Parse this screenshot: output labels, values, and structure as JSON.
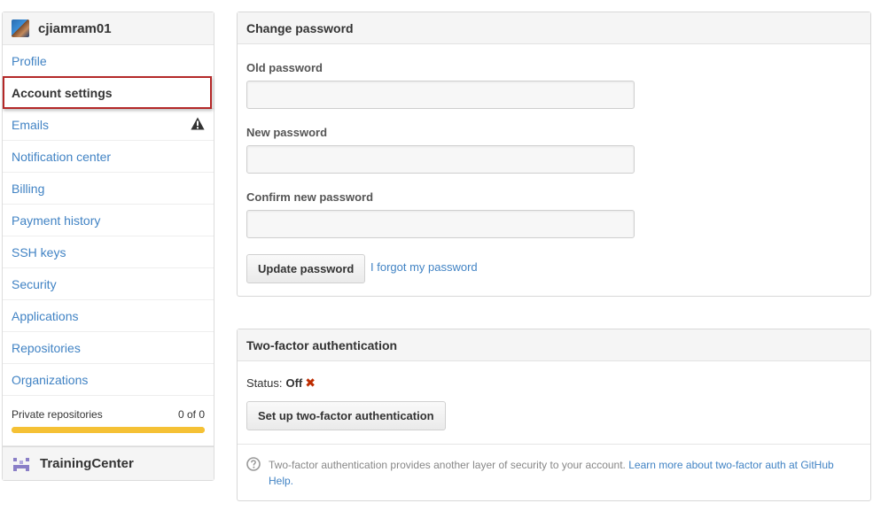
{
  "user": {
    "name": "cjiamram01"
  },
  "sidebar": {
    "items": [
      {
        "label": "Profile"
      },
      {
        "label": "Account settings"
      },
      {
        "label": "Emails"
      },
      {
        "label": "Notification center"
      },
      {
        "label": "Billing"
      },
      {
        "label": "Payment history"
      },
      {
        "label": "SSH keys"
      },
      {
        "label": "Security"
      },
      {
        "label": "Applications"
      },
      {
        "label": "Repositories"
      },
      {
        "label": "Organizations"
      }
    ],
    "private_repos": {
      "label": "Private repositories",
      "count": "0 of 0",
      "fill_fraction": 1.0
    },
    "org": {
      "name": "TrainingCenter"
    }
  },
  "change_password": {
    "title": "Change password",
    "old_label": "Old password",
    "new_label": "New password",
    "confirm_label": "Confirm new password",
    "old_value": "",
    "new_value": "",
    "confirm_value": "",
    "update_button": "Update password",
    "forgot_link": "I forgot my password"
  },
  "two_factor": {
    "title": "Two-factor authentication",
    "status_label": "Status:",
    "status_value": "Off",
    "status_mark": "✖",
    "setup_button": "Set up two-factor authentication",
    "help_text": "Two-factor authentication provides another layer of security to your account.",
    "help_link": "Learn more about two-factor auth at GitHub Help."
  },
  "colors": {
    "link": "#4183c4",
    "selection_outline": "#b42828",
    "progress": "#f5c135",
    "status_off": "#bd2c00"
  }
}
